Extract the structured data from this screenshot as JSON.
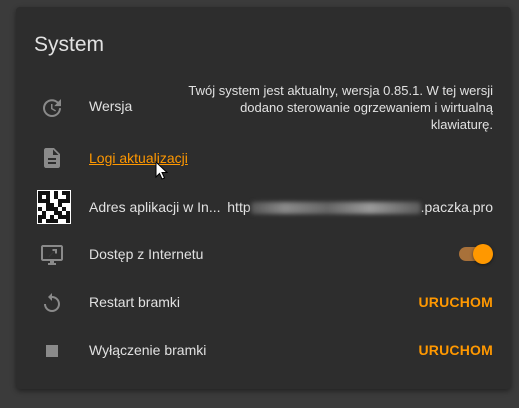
{
  "card": {
    "title": "System"
  },
  "rows": {
    "version": {
      "icon": "update-icon",
      "label": "Wersja",
      "value_lines": [
        "Twój system jest aktualny, wersja 0.85.1. W tej wersji",
        "dodano sterowanie ogrzewaniem i wirtualną",
        "klawiaturę."
      ]
    },
    "logs": {
      "icon": "document-icon",
      "label": "Logi aktualizacji"
    },
    "app_address": {
      "icon": "qr-code-icon",
      "label": "Adres aplikacji w In...",
      "value_prefix": "http",
      "value_suffix": ".paczka.pro"
    },
    "internet_access": {
      "icon": "remote-desktop-icon",
      "label": "Dostęp z Internetu",
      "enabled": true
    },
    "restart": {
      "icon": "restart-icon",
      "label": "Restart bramki",
      "action": "URUCHOM"
    },
    "shutdown": {
      "icon": "stop-icon",
      "label": "Wyłączenie bramki",
      "action": "URUCHOM"
    }
  },
  "colors": {
    "accent": "#ff9800",
    "card_bg": "#2d2d2d",
    "page_bg": "#3b3b3b",
    "text": "#e1e1e1",
    "icon": "#8a8a8a"
  }
}
